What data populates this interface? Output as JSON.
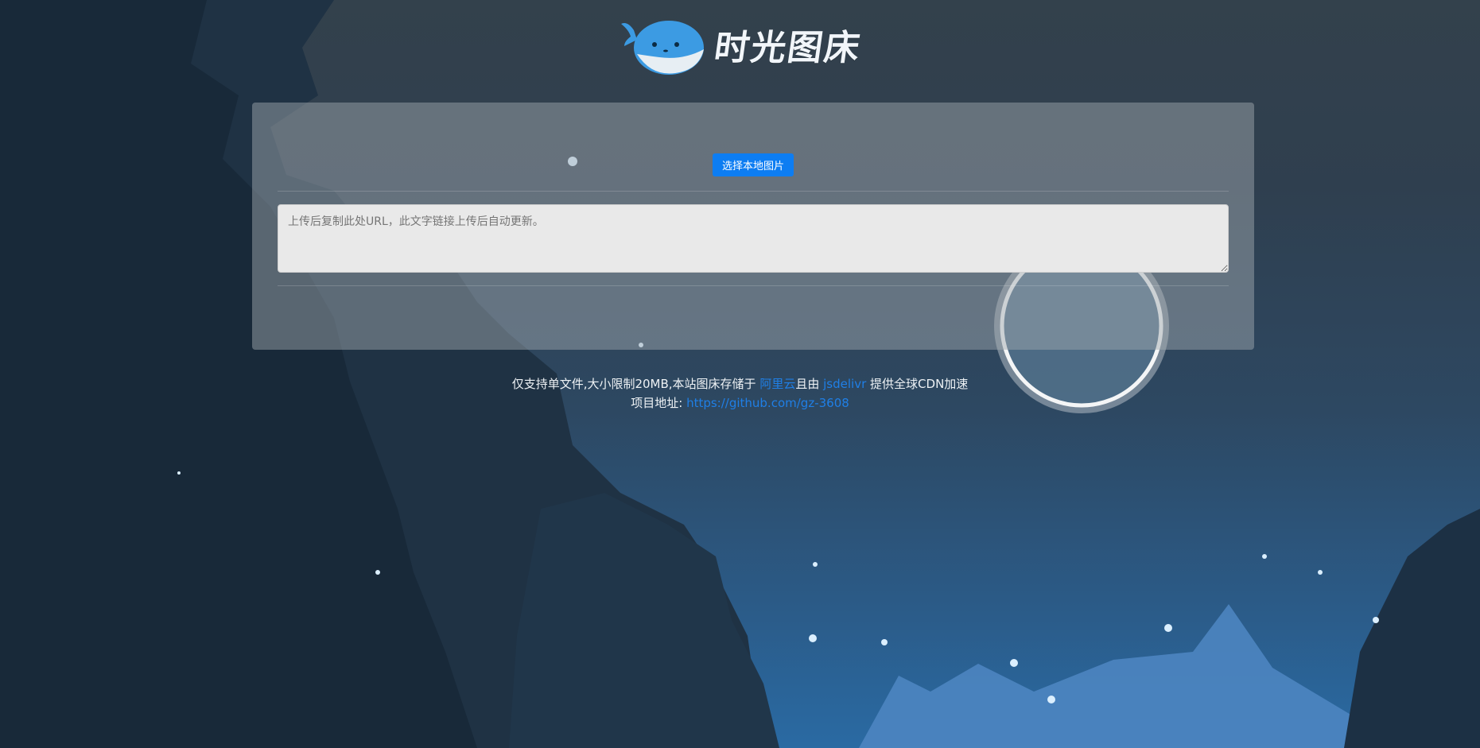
{
  "header": {
    "logo_text": "时光图床"
  },
  "upload": {
    "button_label": "选择本地图片"
  },
  "url_box": {
    "placeholder": "上传后复制此处URL，此文字链接上传后自动更新。"
  },
  "footer": {
    "line1_prefix": "仅支持单文件,大小限制20MB,本站图床存储于",
    "storage_link": "阿里云",
    "line1_middle": "且由",
    "cdn_link": "jsdelivr",
    "line1_suffix": "提供全球CDN加速",
    "line2_prefix": "项目地址:",
    "project_link": "https://github.com/gz-3608"
  },
  "colors": {
    "accent": "#0d7df2",
    "link": "#1f7fe6"
  }
}
